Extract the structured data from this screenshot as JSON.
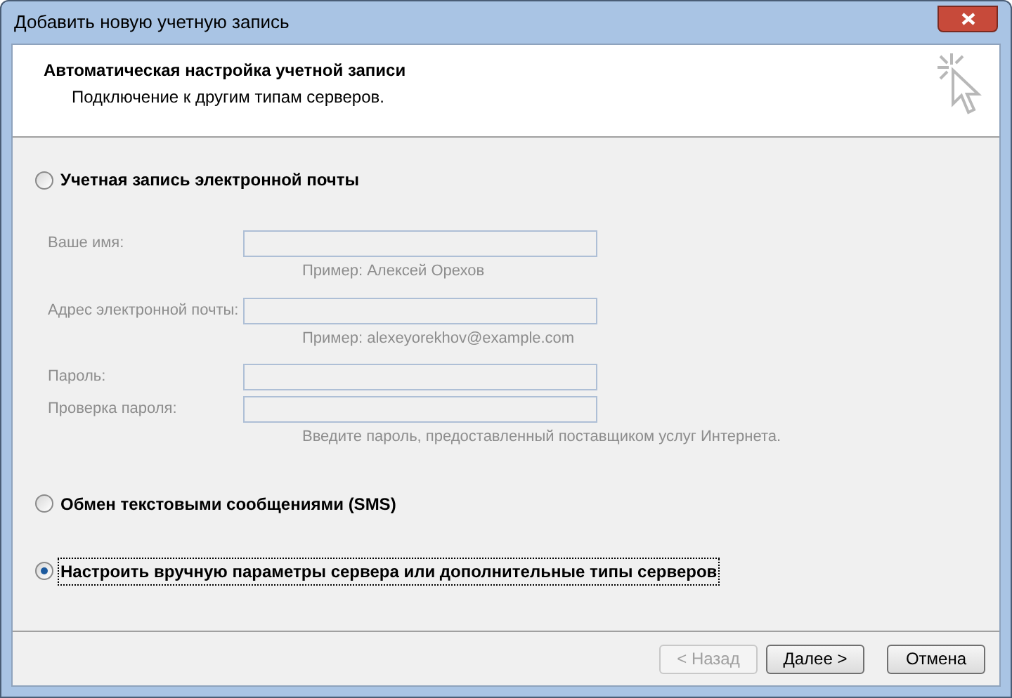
{
  "window": {
    "title": "Добавить новую учетную запись"
  },
  "header": {
    "title": "Автоматическая настройка учетной записи",
    "subtitle": "Подключение к другим типам серверов."
  },
  "options": [
    {
      "kind": "form",
      "label": "Учетная запись электронной почты",
      "selected": false,
      "fields": [
        {
          "label": "Ваше имя:",
          "hint": "Пример: Алексей Орехов",
          "disabled": true
        },
        {
          "label": "Адрес электронной почты:",
          "hint": "Пример: alexeyorekhov@example.com",
          "disabled": true
        },
        {
          "label": "Пароль:",
          "disabled": true
        },
        {
          "label": "Проверка пароля:",
          "hint": "Введите пароль, предоставленный поставщиком услуг Интернета.",
          "disabled": true
        }
      ]
    },
    {
      "kind": "plain",
      "label": "Обмен текстовыми сообщениями (SMS)",
      "selected": false
    },
    {
      "kind": "plain",
      "label": "Настроить вручную параметры сервера или дополнительные типы серверов",
      "selected": true
    }
  ],
  "buttons": [
    {
      "label": "< Назад",
      "disabled": true
    },
    {
      "label": "Далее >",
      "disabled": false
    },
    {
      "label": "Отмена",
      "disabled": false
    }
  ]
}
